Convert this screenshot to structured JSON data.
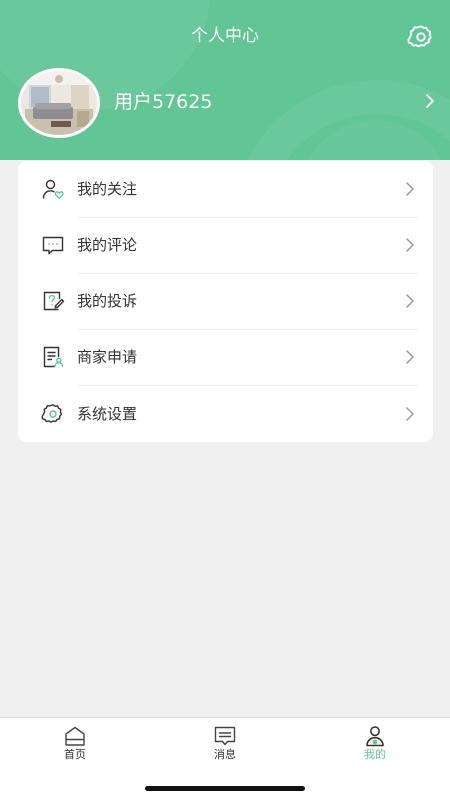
{
  "header": {
    "title": "个人中心",
    "settings_icon": "gear-icon",
    "background_color": "#62c596"
  },
  "profile": {
    "avatar": "room-photo-avatar",
    "username": "用户57625",
    "chevron_icon": "chevron-right-icon"
  },
  "menu": {
    "items": [
      {
        "label": "我的关注",
        "icon": "user-heart-icon"
      },
      {
        "label": "我的评论",
        "icon": "comment-icon"
      },
      {
        "label": "我的投诉",
        "icon": "complaint-icon"
      },
      {
        "label": "商家申请",
        "icon": "merchant-apply-icon"
      },
      {
        "label": "系统设置",
        "icon": "gear-icon"
      }
    ]
  },
  "tabbar": {
    "active_color": "#62c596",
    "tabs": [
      {
        "label": "首页",
        "icon": "home-icon",
        "active": false
      },
      {
        "label": "消息",
        "icon": "message-icon",
        "active": false
      },
      {
        "label": "我的",
        "icon": "user-icon",
        "active": true
      }
    ]
  }
}
